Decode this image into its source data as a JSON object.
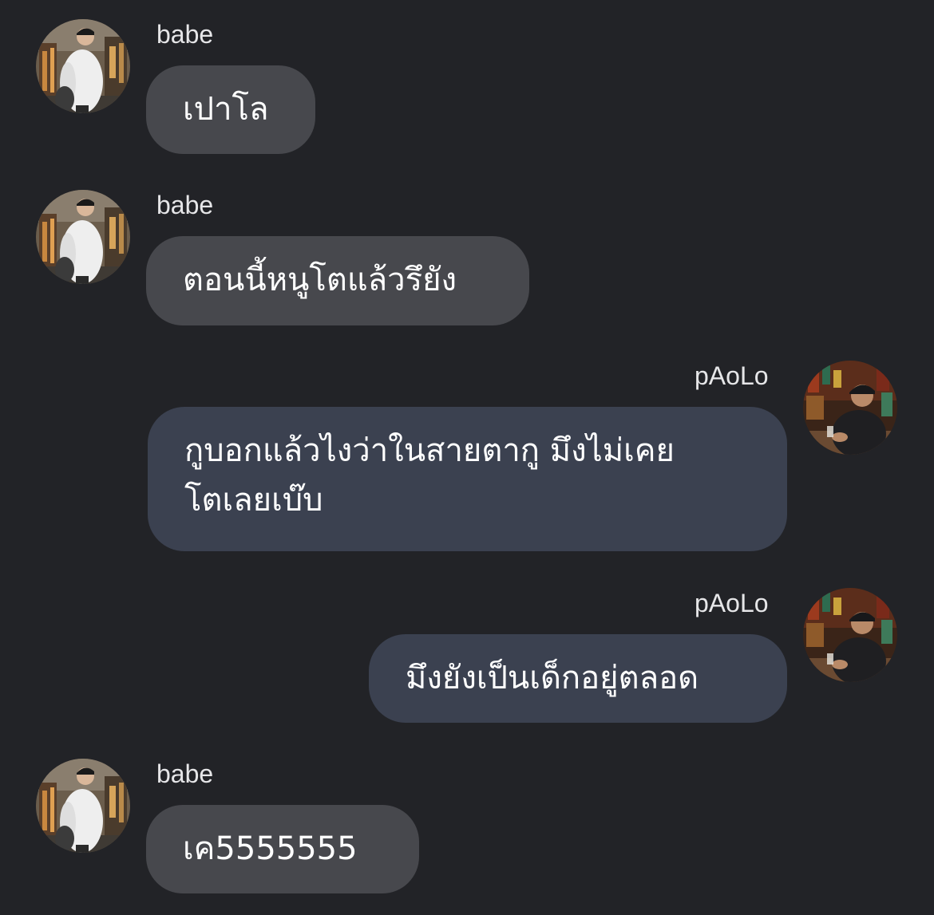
{
  "colors": {
    "background": "#222327",
    "incoming_bubble": "#47484d",
    "outgoing_bubble": "#3b4150",
    "text": "#ffffff",
    "sender_name": "#e6e6e8"
  },
  "messages": [
    {
      "sender": "babe",
      "direction": "incoming",
      "avatar": "babe-avatar",
      "text": "เปาโล"
    },
    {
      "sender": "babe",
      "direction": "incoming",
      "avatar": "babe-avatar",
      "text": "ตอนนี้หนูโตแล้วรึยัง"
    },
    {
      "sender": "pAoLo",
      "direction": "outgoing",
      "avatar": "paolo-avatar",
      "text_line1": "กูบอกแล้วไงว่าในสายตากู มึงไม่เคย",
      "text_line2": "โตเลยเบ๊บ"
    },
    {
      "sender": "pAoLo",
      "direction": "outgoing",
      "avatar": "paolo-avatar",
      "text": "มึงยังเป็นเด็กอยู่ตลอด"
    },
    {
      "sender": "babe",
      "direction": "incoming",
      "avatar": "babe-avatar",
      "text": "เค5555555"
    }
  ]
}
